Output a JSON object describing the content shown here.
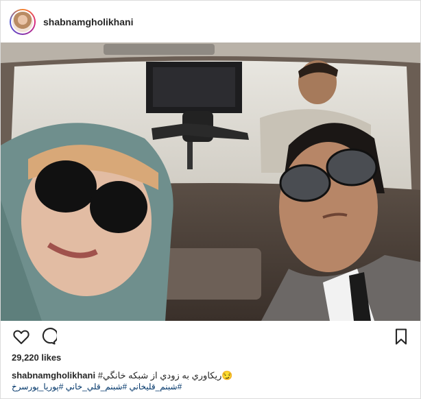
{
  "post": {
    "username": "shabnamgholikhani",
    "likes": "29,220 likes",
    "caption_user": "shabnamgholikhani",
    "caption_text": "#ريكاوري به زودي از شبكه خانگي",
    "caption_emoji": "😏",
    "hashtags": "#شبنم_قليخاني #شبنم_قلي_خاني #پوريا_پورسرخ"
  },
  "icons": {
    "like": "heart-icon",
    "comment": "comment-icon",
    "save": "bookmark-icon"
  },
  "colors": {
    "text": "#262626",
    "hashtag": "#003569",
    "border": "#dbdbdb"
  }
}
